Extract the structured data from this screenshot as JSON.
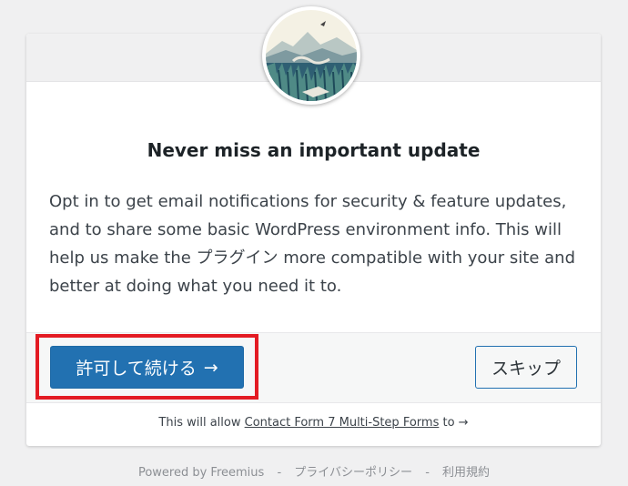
{
  "dialog": {
    "title": "Never miss an important update",
    "description": "Opt in to get email notifications for security & feature updates, and to share some basic WordPress environment info. This will help us make the プラグイン more compatible with your site and better at doing what you need it to.",
    "primary_button": "許可して続ける",
    "primary_arrow": "→",
    "skip_button": "スキップ",
    "permissions_prefix": "This will allow ",
    "permissions_link": "Contact Form 7 Multi-Step Forms",
    "permissions_suffix": " to ",
    "permissions_arrow": "→"
  },
  "footer": {
    "powered_by": "Powered by Freemius",
    "separator_1": "-",
    "privacy": "プライバシーポリシー",
    "separator_2": "-",
    "terms": "利用規約"
  },
  "colors": {
    "primary": "#2271b1",
    "highlight": "#e31b23",
    "background": "#f0f0f1"
  },
  "icons": {
    "primary_arrow": "arrow-right-icon",
    "permissions_arrow": "arrow-right-icon"
  }
}
